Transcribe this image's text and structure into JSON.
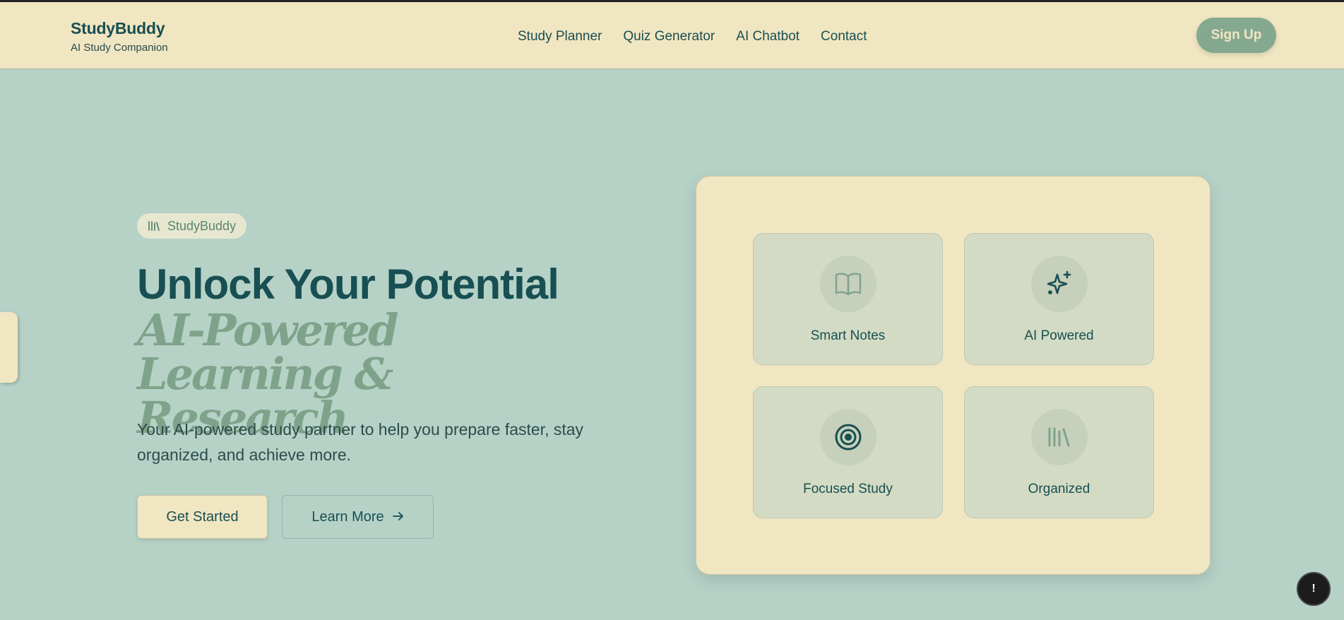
{
  "header": {
    "brand_title": "StudyBuddy",
    "brand_subtitle": "AI Study Companion",
    "nav": [
      "Study Planner",
      "Quiz Generator",
      "AI Chatbot",
      "Contact"
    ],
    "signup_label": "Sign Up"
  },
  "hero": {
    "badge": "StudyBuddy",
    "title": "Unlock Your Potential",
    "subtitle": "AI-Powered Learning & Research",
    "description": "Your AI-powered study partner to help you prepare faster, stay organized, and achieve more.",
    "primary_button": "Get Started",
    "secondary_button": "Learn More"
  },
  "features": [
    {
      "label": "Smart Notes",
      "icon": "book-open-icon"
    },
    {
      "label": "AI Powered",
      "icon": "sparkles-icon"
    },
    {
      "label": "Focused Study",
      "icon": "target-icon"
    },
    {
      "label": "Organized",
      "icon": "library-icon"
    }
  ],
  "floating_button": "!",
  "colors": {
    "page_bg": "#b6d2c7",
    "cream": "#f1e6c2",
    "teal_dark": "#184f52",
    "sage": "#85a98f",
    "tile_bg": "#d3dbc4"
  }
}
